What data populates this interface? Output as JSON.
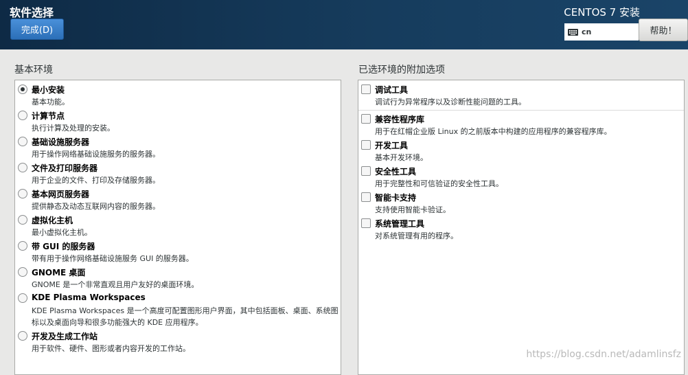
{
  "header": {
    "title": "软件选择",
    "done_label": "完成(D)",
    "product": "CENTOS 7 安装",
    "keyboard_layout": "cn",
    "help_label": "帮助！"
  },
  "base_env": {
    "label": "基本环境",
    "items": [
      {
        "name": "最小安装",
        "desc": "基本功能。",
        "selected": true
      },
      {
        "name": "计算节点",
        "desc": "执行计算及处理的安装。",
        "selected": false
      },
      {
        "name": "基础设施服务器",
        "desc": "用于操作网络基础设施服务的服务器。",
        "selected": false
      },
      {
        "name": "文件及打印服务器",
        "desc": "用于企业的文件、打印及存储服务器。",
        "selected": false
      },
      {
        "name": "基本网页服务器",
        "desc": "提供静态及动态互联网内容的服务器。",
        "selected": false
      },
      {
        "name": "虚拟化主机",
        "desc": "最小虚拟化主机。",
        "selected": false
      },
      {
        "name": "带 GUI 的服务器",
        "desc": "带有用于操作网络基础设施服务 GUI 的服务器。",
        "selected": false
      },
      {
        "name": "GNOME 桌面",
        "desc": "GNOME 是一个非常直观且用户友好的桌面环境。",
        "selected": false
      },
      {
        "name": "KDE Plasma Workspaces",
        "desc": "KDE Plasma Workspaces 是一个高度可配置图形用户界面，其中包括面板、桌面、系统图标以及桌面向导和很多功能强大的 KDE 应用程序。",
        "selected": false
      },
      {
        "name": "开发及生成工作站",
        "desc": "用于软件、硬件、图形或者内容开发的工作站。",
        "selected": false
      }
    ]
  },
  "addons": {
    "label": "已选环境的附加选项",
    "items": [
      {
        "name": "调试工具",
        "desc": "调试行为异常程序以及诊断性能问题的工具。",
        "checked": false
      },
      {
        "name": "兼容性程序库",
        "desc": "用于在红帽企业版 Linux 的之前版本中构建的应用程序的兼容程序库。",
        "checked": false
      },
      {
        "name": "开发工具",
        "desc": "基本开发环境。",
        "checked": false
      },
      {
        "name": "安全性工具",
        "desc": "用于完整性和可信验证的安全性工具。",
        "checked": false
      },
      {
        "name": "智能卡支持",
        "desc": "支持使用智能卡验证。",
        "checked": false
      },
      {
        "name": "系统管理工具",
        "desc": "对系统管理有用的程序。",
        "checked": false
      }
    ]
  },
  "watermark": "https://blog.csdn.net/adamlinsfz"
}
